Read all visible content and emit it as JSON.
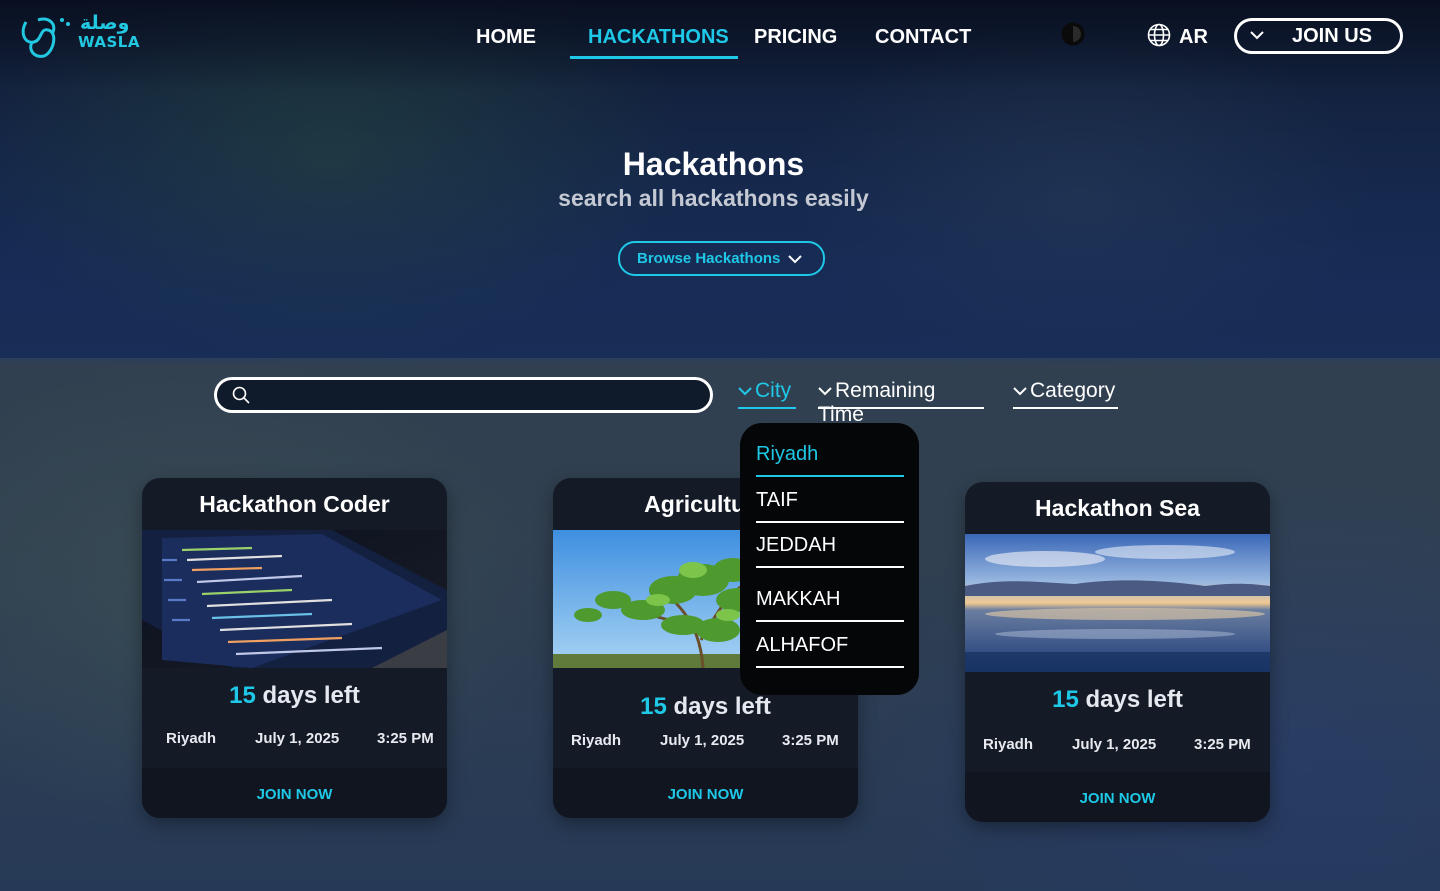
{
  "header": {
    "logo_arabic": "وصلة",
    "logo_english": "WASLA",
    "nav": [
      {
        "label": "HOME",
        "active": false
      },
      {
        "label": "HACKATHONS",
        "active": true
      },
      {
        "label": "PRICING",
        "active": false
      },
      {
        "label": "CONTACT",
        "active": false
      }
    ],
    "theme_icon": "contrast-icon",
    "language_icon": "globe-icon",
    "language_label": "AR",
    "join_label": "JOIN US"
  },
  "hero": {
    "title": "Hackathons",
    "subtitle": "search all hackathons easily",
    "browse_label": "Browse Hackathons"
  },
  "filters": {
    "search_value": "",
    "items": [
      {
        "label": "City",
        "active": true
      },
      {
        "label": "Remaining Time",
        "active": false
      },
      {
        "label": "Category",
        "active": false
      }
    ]
  },
  "city_dropdown": {
    "options": [
      {
        "label": "Riyadh",
        "selected": true
      },
      {
        "label": "TAIF",
        "selected": false
      },
      {
        "label": "JEDDAH",
        "selected": false
      },
      {
        "label": "MAKKAH",
        "selected": false
      },
      {
        "label": "ALHAFOF",
        "selected": false
      }
    ]
  },
  "cards": [
    {
      "title": "Hackathon Coder",
      "days_num": "15",
      "days_text": "days left",
      "city": "Riyadh",
      "date": "July 1, 2025",
      "time": "3:25 PM",
      "join_label": "JOIN NOW"
    },
    {
      "title": "Agriculture",
      "days_num": "15",
      "days_text": "days left",
      "city": "Riyadh",
      "date": "July 1, 2025",
      "time": "3:25 PM",
      "join_label": "JOIN NOW"
    },
    {
      "title": "Hackathon Sea",
      "days_num": "15",
      "days_text": "days left",
      "city": "Riyadh",
      "date": "July 1, 2025",
      "time": "3:25 PM",
      "join_label": "JOIN NOW"
    }
  ],
  "colors": {
    "accent": "#1ec8e6",
    "card_bg": "#141a26",
    "dropdown_bg": "#050608"
  }
}
